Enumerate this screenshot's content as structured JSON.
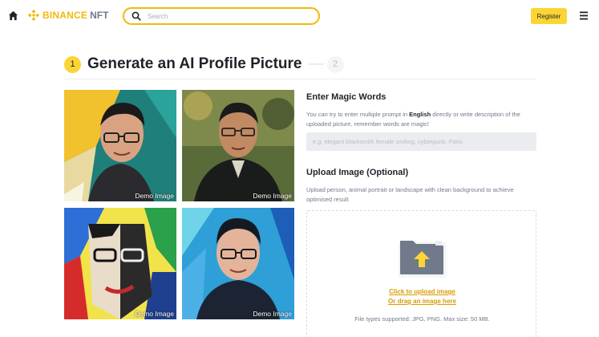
{
  "nav": {
    "logo_text": "BINANCE",
    "logo_suffix": "NFT",
    "search_placeholder": "Search",
    "register_label": "Register",
    "accent_color": "#f0b90b",
    "button_color": "#fcd535"
  },
  "stepper": {
    "step1": "1",
    "step2": "2",
    "title": "Generate an AI Profile Picture"
  },
  "gallery": {
    "items": [
      {
        "label": "Demo Image",
        "icon": "portrait-glasses-yellow-bg"
      },
      {
        "label": "Demo Image",
        "icon": "portrait-dark-suit"
      },
      {
        "label": "Demo Image",
        "icon": "cubist-portrait"
      },
      {
        "label": "Demo Image",
        "icon": "portrait-blue-teal-bg"
      }
    ]
  },
  "magic_words": {
    "title": "Enter Magic Words",
    "desc_before": "You can try to enter multiple prompt in ",
    "desc_bold": "English",
    "desc_after": " directly or write description of the uploaded picture, remember words are magic!",
    "placeholder": "e.g. elegant blacksmith female smiling, cyberpunk, Paris"
  },
  "upload": {
    "title": "Upload Image (Optional)",
    "desc": "Upload person, animal portrait or landscape with clean background to achieve optimised result",
    "click_label": "Click to upload image",
    "drag_label": "Or drag an image here",
    "note": "File types supported: JPG, PNG. Max size: 50 MB.",
    "icon": "folder-upload-icon"
  }
}
